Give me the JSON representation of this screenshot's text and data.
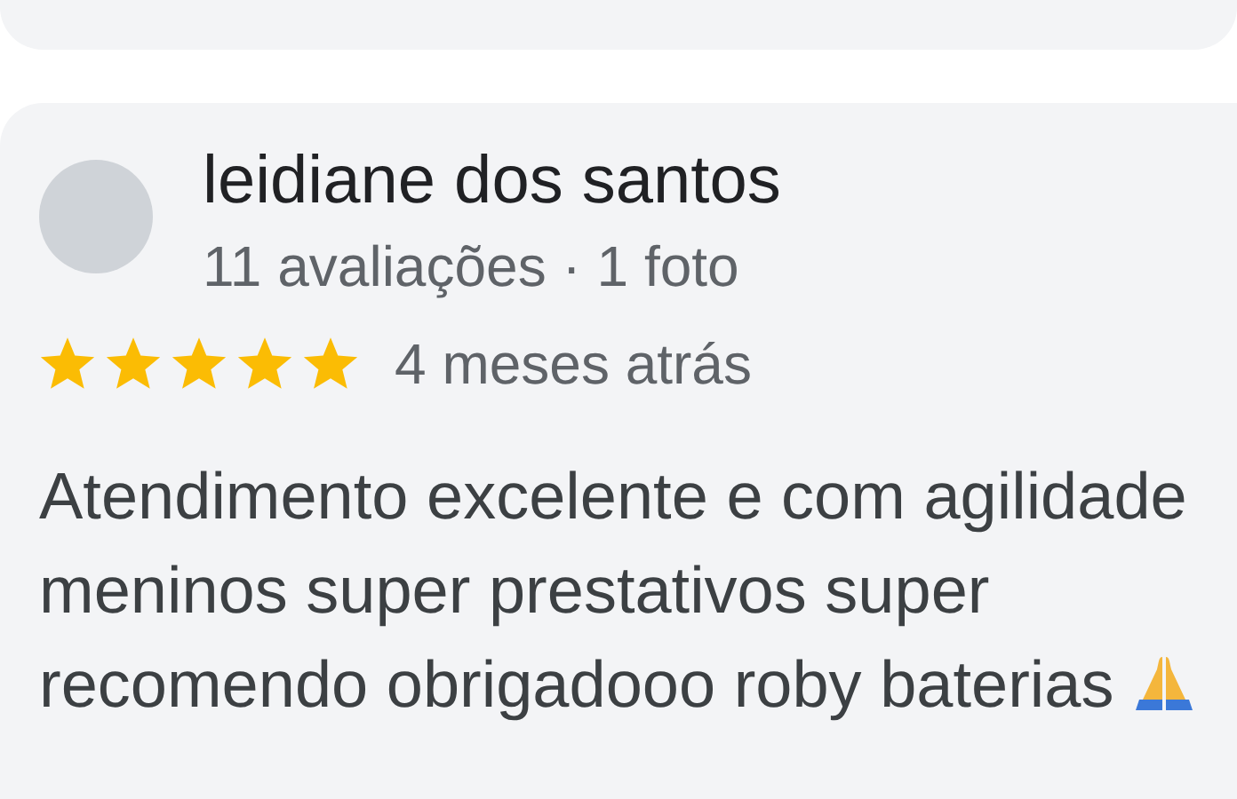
{
  "review": {
    "author": "leidiane dos santos",
    "meta": "11 avaliações · 1 foto",
    "stars": 5,
    "time": "4 meses atrás",
    "text": "Atendimento excelente e com agilidade meninos super prestativos super recomendo obrigadooo roby baterias"
  }
}
